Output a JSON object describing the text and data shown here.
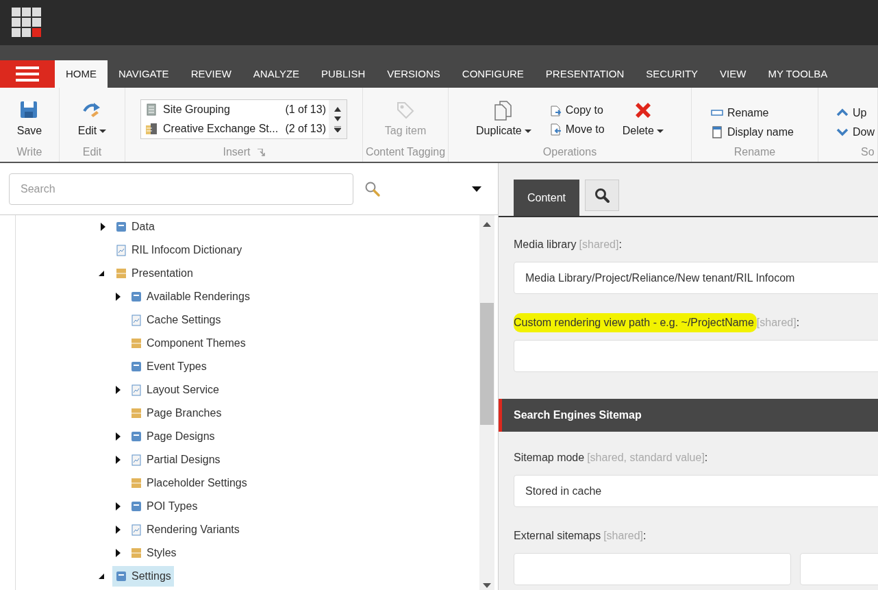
{
  "tabs": [
    {
      "label": "HOME",
      "selected": true
    },
    {
      "label": "NAVIGATE",
      "selected": false
    },
    {
      "label": "REVIEW",
      "selected": false
    },
    {
      "label": "ANALYZE",
      "selected": false
    },
    {
      "label": "PUBLISH",
      "selected": false
    },
    {
      "label": "VERSIONS",
      "selected": false
    },
    {
      "label": "CONFIGURE",
      "selected": false
    },
    {
      "label": "PRESENTATION",
      "selected": false
    },
    {
      "label": "SECURITY",
      "selected": false
    },
    {
      "label": "VIEW",
      "selected": false
    },
    {
      "label": "MY TOOLBA",
      "selected": false
    }
  ],
  "ribbon": [
    {
      "label": "Write",
      "items": [
        {
          "kind": "large",
          "label": "Save",
          "dropdown": false,
          "disabled": false
        }
      ]
    },
    {
      "label": "Edit",
      "items": [
        {
          "kind": "large",
          "label": "Edit",
          "dropdown": true,
          "disabled": false
        }
      ]
    },
    {
      "label": "Insert",
      "launcher": true,
      "items": [
        {
          "kind": "listbox",
          "entries": [
            {
              "name": "Site Grouping",
              "count": "(1 of 13)"
            },
            {
              "name": "Creative Exchange St...",
              "count": "(2 of 13)"
            }
          ]
        }
      ]
    },
    {
      "label": "Content Tagging",
      "items": [
        {
          "kind": "large",
          "label": "Tag item",
          "dropdown": false,
          "disabled": true
        }
      ]
    },
    {
      "label": "Operations",
      "items": [
        {
          "kind": "large",
          "label": "Duplicate",
          "dropdown": true,
          "disabled": false
        },
        {
          "kind": "small",
          "entries": [
            "Copy to",
            "Move to"
          ]
        },
        {
          "kind": "large",
          "label": "Delete",
          "dropdown": true,
          "disabled": false
        }
      ]
    },
    {
      "label": "Rename",
      "items": [
        {
          "kind": "small",
          "entries": [
            "Rename",
            "Display name"
          ]
        }
      ]
    },
    {
      "label": "So",
      "items": [
        {
          "kind": "small",
          "entries": [
            "Up",
            "Dow"
          ]
        }
      ]
    }
  ],
  "search": {
    "placeholder": "Search"
  },
  "tree": [
    {
      "label": "Data",
      "expanded": false,
      "selected": false
    },
    {
      "label": "RIL Infocom Dictionary",
      "selected": false
    },
    {
      "label": "Presentation",
      "expanded": true,
      "selected": false,
      "children": [
        {
          "label": "Available Renderings",
          "expanded": false,
          "selected": false
        },
        {
          "label": "Cache Settings",
          "selected": false
        },
        {
          "label": "Component Themes",
          "selected": false
        },
        {
          "label": "Event Types",
          "selected": false
        },
        {
          "label": "Layout Service",
          "expanded": false,
          "selected": false
        },
        {
          "label": "Page Branches",
          "selected": false
        },
        {
          "label": "Page Designs",
          "expanded": false,
          "selected": false
        },
        {
          "label": "Partial Designs",
          "expanded": false,
          "selected": false
        },
        {
          "label": "Placeholder Settings",
          "selected": false
        },
        {
          "label": "POI Types",
          "expanded": false,
          "selected": false
        },
        {
          "label": "Rendering Variants",
          "expanded": false,
          "selected": false
        },
        {
          "label": "Styles",
          "expanded": false,
          "selected": false
        }
      ]
    },
    {
      "label": "Settings",
      "expanded": true,
      "selected": true
    }
  ],
  "editor_tabs": [
    {
      "kind": "text",
      "label": "Content",
      "selected": true
    },
    {
      "kind": "search",
      "selected": false
    }
  ],
  "sections": [
    {
      "fields": [
        {
          "label": "Media library",
          "qualifier": "[shared]",
          "suffix": ":",
          "highlighted": false,
          "kind": "single",
          "value": "Media Library/Project/Reliance/New tenant/RIL Infocom"
        },
        {
          "label": "Custom rendering view path - e.g. ~/ProjectName",
          "qualifier": "[shared]",
          "suffix": ":",
          "highlighted": true,
          "kind": "single"
        }
      ]
    },
    {
      "title": "Search Engines Sitemap",
      "fields": [
        {
          "label": "Sitemap mode",
          "qualifier": "[shared, standard value]",
          "suffix": ":",
          "highlighted": false,
          "kind": "single",
          "value": "Stored in cache"
        },
        {
          "label": "External sitemaps",
          "qualifier": "[shared]",
          "suffix": ":",
          "highlighted": false,
          "kind": "pair"
        }
      ]
    }
  ]
}
